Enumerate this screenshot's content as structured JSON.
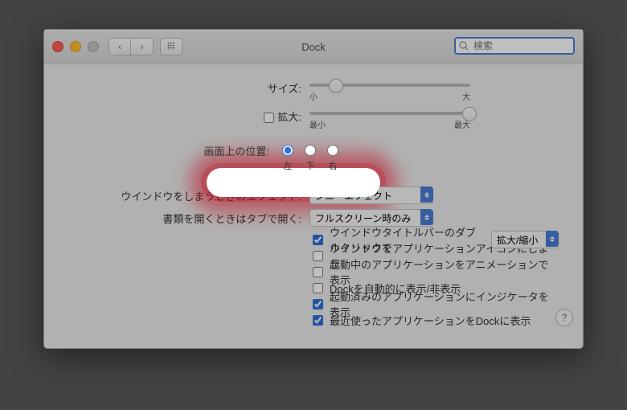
{
  "title": "Dock",
  "search": {
    "placeholder": "検索"
  },
  "rows": {
    "size": {
      "label": "サイズ:",
      "min": "小",
      "max": "大"
    },
    "magnify": {
      "label": "拡大:",
      "min": "最小",
      "max": "最大"
    },
    "position": {
      "label": "画面上の位置:",
      "options": [
        "左",
        "下",
        "右"
      ],
      "selected": 0
    },
    "minimize_effect": {
      "label": "ウインドウをしまうときのエフェクト:",
      "value": "ジニーエフェクト"
    },
    "open_tabs": {
      "label": "書類を開くときはタブで開く:",
      "value": "フルスクリーン時のみ"
    }
  },
  "checks": [
    {
      "checked": true,
      "label": "ウインドウタイトルバーのダブルクリックで",
      "select": "拡大/縮小"
    },
    {
      "checked": false,
      "label": "ウインドウをアプリケーションアイコンにしまう"
    },
    {
      "checked": false,
      "label": "起動中のアプリケーションをアニメーションで表示"
    },
    {
      "checked": false,
      "label": "Dockを自動的に表示/非表示"
    },
    {
      "checked": true,
      "label": "起動済みのアプリケーションにインジケータを表示"
    },
    {
      "checked": true,
      "label": "最近使ったアプリケーションをDockに表示"
    }
  ],
  "help": "?"
}
